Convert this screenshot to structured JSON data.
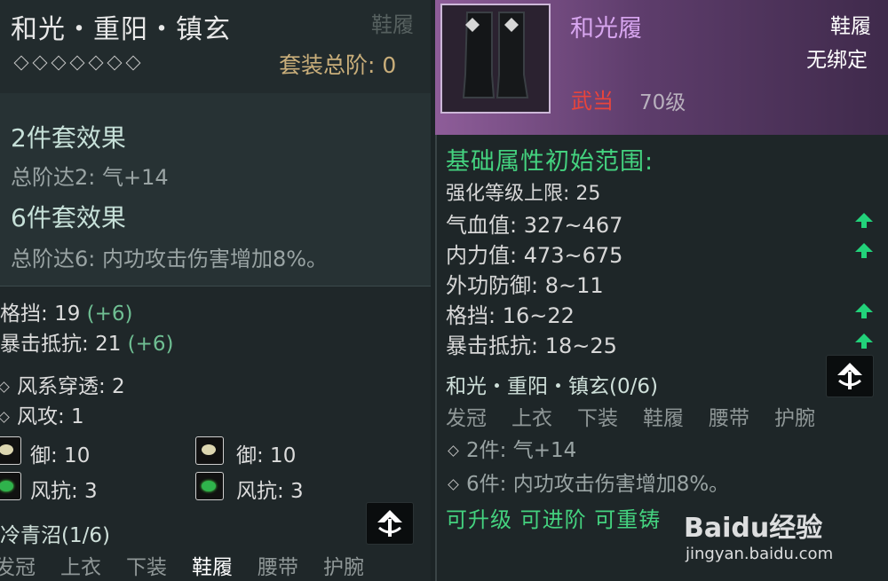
{
  "left": {
    "set_name": "和光・重阳・镇玄",
    "corner_label": "鞋履",
    "set_rank_label": "套装总阶: 0",
    "set2_title": "2件套效果",
    "set2_desc": "总阶达2: 气+14",
    "set6_title": "6件套效果",
    "set6_desc": "总阶达6: 内功攻击伤害增加8%。",
    "parry": {
      "label": "格挡:",
      "value": "19",
      "bonus": "(+6)"
    },
    "crit_res": {
      "label": "暴击抵抗:",
      "value": "21",
      "bonus": "(+6)"
    },
    "wind_pen": "风系穿透:  2",
    "wind_atk": "风攻:  1",
    "gem_rows": [
      {
        "a": "御:  10",
        "b": "御:  10"
      },
      {
        "a": "风抗:  3",
        "b": "风抗:  3"
      }
    ],
    "set2_name": "冷青沼(1/6)",
    "tabs": [
      "发冠",
      "上衣",
      "下装",
      "鞋履",
      "腰带",
      "护腕"
    ],
    "active_tab_index": 3
  },
  "right": {
    "item_name": "和光履",
    "slot": "鞋履",
    "bind": "无绑定",
    "sect": "武当",
    "level": "70级",
    "base_title": "基础属性初始范围:",
    "enhance_limit": "强化等级上限: 25",
    "stats": [
      {
        "label": "气血值:  327~467",
        "upgrade": true
      },
      {
        "label": "内力值:  473~675",
        "upgrade": true
      },
      {
        "label": "外功防御:  8~11",
        "upgrade": false
      },
      {
        "label": "格挡:  16~22",
        "upgrade": true
      },
      {
        "label": "暴击抵抗:  18~25",
        "upgrade": true
      }
    ],
    "set_name": "和光・重阳・镇玄(0/6)",
    "tabs": [
      "发冠",
      "上衣",
      "下装",
      "鞋履",
      "腰带",
      "护腕"
    ],
    "set2_desc": "2件: 气+14",
    "set6_desc": "6件: 内功攻击伤害增加8%。",
    "actions": "可升级 可进阶 可重铸"
  },
  "watermark": {
    "brand": "Baidu经验",
    "url": "jingyan.baidu.com"
  },
  "colors": {
    "green": "#44d27f",
    "red": "#e8443c",
    "purple_name": "#d8a6f0",
    "gold": "#c9ae7a"
  }
}
